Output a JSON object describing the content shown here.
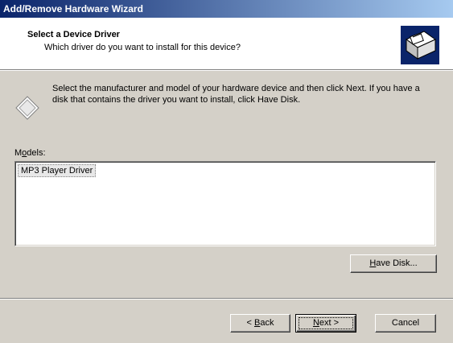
{
  "window": {
    "title": "Add/Remove Hardware Wizard"
  },
  "header": {
    "title": "Select a Device Driver",
    "subtitle": "Which driver do you want to install for this device?"
  },
  "info": {
    "text": "Select the manufacturer and model of your hardware device and then click Next. If you have a disk that contains the driver you want to install, click Have Disk."
  },
  "models": {
    "label_pre": "M",
    "label_accel": "o",
    "label_post": "dels:",
    "items": [
      "MP3 Player Driver"
    ]
  },
  "buttons": {
    "have_disk": {
      "accel": "H",
      "rest": "ave Disk..."
    },
    "back": {
      "pre": "< ",
      "accel": "B",
      "rest": "ack"
    },
    "next": {
      "accel": "N",
      "rest": "ext >"
    },
    "cancel": "Cancel"
  },
  "icons": {
    "wizard": "hardware-wizard-icon",
    "info": "diamond-info-icon"
  },
  "colors": {
    "titlebar_start": "#0a246a",
    "titlebar_end": "#a6caf0",
    "dialog_face": "#d4d0c8"
  }
}
